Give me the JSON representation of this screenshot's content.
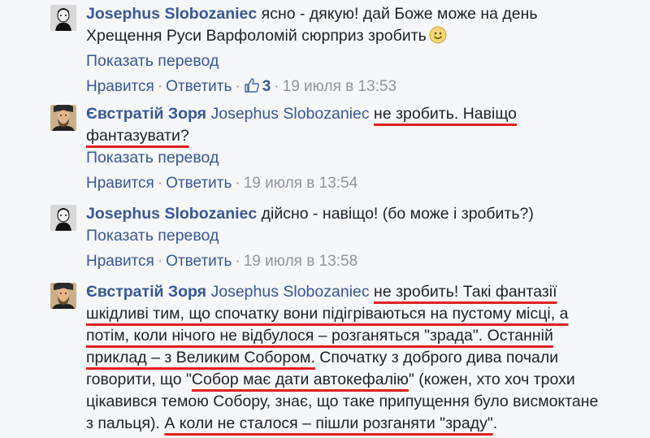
{
  "thread": {
    "translate_label": "Показать перевод",
    "like_label": "Нравится",
    "reply_label": "Ответить",
    "comments": [
      {
        "author": "Josephus Slobozaniec",
        "text": "ясно - дякую! дай Боже може на день Хрещення Руси Варфоломій сюрприз зробить",
        "emoji": "smile-emoji",
        "likes": "3",
        "timestamp": "19 июля в 13:53"
      },
      {
        "author": "Євстратій Зоря",
        "mention": "Josephus Slobozaniec",
        "text": "не зробить. Навіщо фантазувати?",
        "timestamp": "19 июля в 13:54"
      },
      {
        "author": "Josephus Slobozaniec",
        "text": "дійсно - навіщо! (бо може і зробить?)",
        "timestamp": "19 июля в 13:58"
      },
      {
        "author": "Євстратій Зоря",
        "mention": "Josephus Slobozaniec",
        "text_parts": [
          "не зробить! Такі фантазії шкідливі тим, що спочатку вони підігріваються на пустому місці, а потім, коли нічого не відбулося – розганяться \"зрада\". Останній приклад – з Великим Собором.",
          " Спочатку з доброго дива почали говорити, що \"",
          "Собор має дати автокефалію",
          "\" (кожен, хто хоч трохи цікавився темою Собору, знає, що таке припущення було висмоктане з пальця). ",
          "А коли не сталося – пішли розганяти \"зраду\"",
          "."
        ]
      }
    ],
    "colors": {
      "link": "#365899",
      "meta": "#90949c",
      "underline": "#e02020",
      "background": "#f6f7f9"
    }
  }
}
